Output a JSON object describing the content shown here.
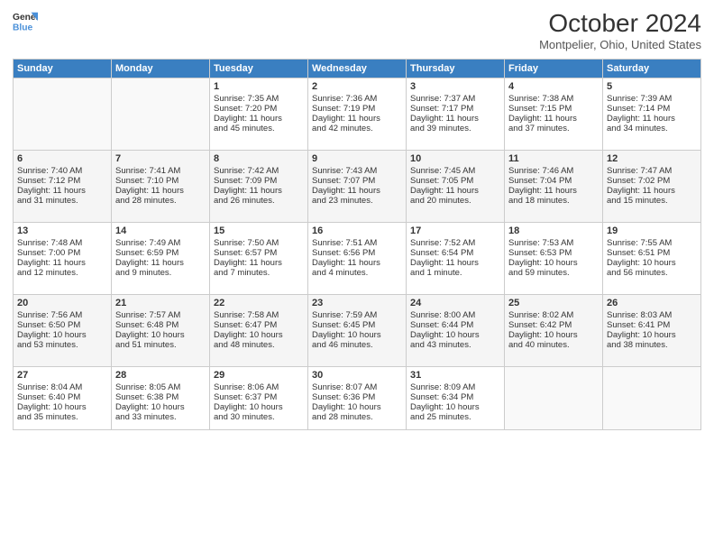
{
  "header": {
    "logo_line1": "General",
    "logo_line2": "Blue",
    "title": "October 2024",
    "subtitle": "Montpelier, Ohio, United States"
  },
  "columns": [
    "Sunday",
    "Monday",
    "Tuesday",
    "Wednesday",
    "Thursday",
    "Friday",
    "Saturday"
  ],
  "weeks": [
    [
      {
        "day": "",
        "lines": []
      },
      {
        "day": "",
        "lines": []
      },
      {
        "day": "1",
        "lines": [
          "Sunrise: 7:35 AM",
          "Sunset: 7:20 PM",
          "Daylight: 11 hours",
          "and 45 minutes."
        ]
      },
      {
        "day": "2",
        "lines": [
          "Sunrise: 7:36 AM",
          "Sunset: 7:19 PM",
          "Daylight: 11 hours",
          "and 42 minutes."
        ]
      },
      {
        "day": "3",
        "lines": [
          "Sunrise: 7:37 AM",
          "Sunset: 7:17 PM",
          "Daylight: 11 hours",
          "and 39 minutes."
        ]
      },
      {
        "day": "4",
        "lines": [
          "Sunrise: 7:38 AM",
          "Sunset: 7:15 PM",
          "Daylight: 11 hours",
          "and 37 minutes."
        ]
      },
      {
        "day": "5",
        "lines": [
          "Sunrise: 7:39 AM",
          "Sunset: 7:14 PM",
          "Daylight: 11 hours",
          "and 34 minutes."
        ]
      }
    ],
    [
      {
        "day": "6",
        "lines": [
          "Sunrise: 7:40 AM",
          "Sunset: 7:12 PM",
          "Daylight: 11 hours",
          "and 31 minutes."
        ]
      },
      {
        "day": "7",
        "lines": [
          "Sunrise: 7:41 AM",
          "Sunset: 7:10 PM",
          "Daylight: 11 hours",
          "and 28 minutes."
        ]
      },
      {
        "day": "8",
        "lines": [
          "Sunrise: 7:42 AM",
          "Sunset: 7:09 PM",
          "Daylight: 11 hours",
          "and 26 minutes."
        ]
      },
      {
        "day": "9",
        "lines": [
          "Sunrise: 7:43 AM",
          "Sunset: 7:07 PM",
          "Daylight: 11 hours",
          "and 23 minutes."
        ]
      },
      {
        "day": "10",
        "lines": [
          "Sunrise: 7:45 AM",
          "Sunset: 7:05 PM",
          "Daylight: 11 hours",
          "and 20 minutes."
        ]
      },
      {
        "day": "11",
        "lines": [
          "Sunrise: 7:46 AM",
          "Sunset: 7:04 PM",
          "Daylight: 11 hours",
          "and 18 minutes."
        ]
      },
      {
        "day": "12",
        "lines": [
          "Sunrise: 7:47 AM",
          "Sunset: 7:02 PM",
          "Daylight: 11 hours",
          "and 15 minutes."
        ]
      }
    ],
    [
      {
        "day": "13",
        "lines": [
          "Sunrise: 7:48 AM",
          "Sunset: 7:00 PM",
          "Daylight: 11 hours",
          "and 12 minutes."
        ]
      },
      {
        "day": "14",
        "lines": [
          "Sunrise: 7:49 AM",
          "Sunset: 6:59 PM",
          "Daylight: 11 hours",
          "and 9 minutes."
        ]
      },
      {
        "day": "15",
        "lines": [
          "Sunrise: 7:50 AM",
          "Sunset: 6:57 PM",
          "Daylight: 11 hours",
          "and 7 minutes."
        ]
      },
      {
        "day": "16",
        "lines": [
          "Sunrise: 7:51 AM",
          "Sunset: 6:56 PM",
          "Daylight: 11 hours",
          "and 4 minutes."
        ]
      },
      {
        "day": "17",
        "lines": [
          "Sunrise: 7:52 AM",
          "Sunset: 6:54 PM",
          "Daylight: 11 hours",
          "and 1 minute."
        ]
      },
      {
        "day": "18",
        "lines": [
          "Sunrise: 7:53 AM",
          "Sunset: 6:53 PM",
          "Daylight: 10 hours",
          "and 59 minutes."
        ]
      },
      {
        "day": "19",
        "lines": [
          "Sunrise: 7:55 AM",
          "Sunset: 6:51 PM",
          "Daylight: 10 hours",
          "and 56 minutes."
        ]
      }
    ],
    [
      {
        "day": "20",
        "lines": [
          "Sunrise: 7:56 AM",
          "Sunset: 6:50 PM",
          "Daylight: 10 hours",
          "and 53 minutes."
        ]
      },
      {
        "day": "21",
        "lines": [
          "Sunrise: 7:57 AM",
          "Sunset: 6:48 PM",
          "Daylight: 10 hours",
          "and 51 minutes."
        ]
      },
      {
        "day": "22",
        "lines": [
          "Sunrise: 7:58 AM",
          "Sunset: 6:47 PM",
          "Daylight: 10 hours",
          "and 48 minutes."
        ]
      },
      {
        "day": "23",
        "lines": [
          "Sunrise: 7:59 AM",
          "Sunset: 6:45 PM",
          "Daylight: 10 hours",
          "and 46 minutes."
        ]
      },
      {
        "day": "24",
        "lines": [
          "Sunrise: 8:00 AM",
          "Sunset: 6:44 PM",
          "Daylight: 10 hours",
          "and 43 minutes."
        ]
      },
      {
        "day": "25",
        "lines": [
          "Sunrise: 8:02 AM",
          "Sunset: 6:42 PM",
          "Daylight: 10 hours",
          "and 40 minutes."
        ]
      },
      {
        "day": "26",
        "lines": [
          "Sunrise: 8:03 AM",
          "Sunset: 6:41 PM",
          "Daylight: 10 hours",
          "and 38 minutes."
        ]
      }
    ],
    [
      {
        "day": "27",
        "lines": [
          "Sunrise: 8:04 AM",
          "Sunset: 6:40 PM",
          "Daylight: 10 hours",
          "and 35 minutes."
        ]
      },
      {
        "day": "28",
        "lines": [
          "Sunrise: 8:05 AM",
          "Sunset: 6:38 PM",
          "Daylight: 10 hours",
          "and 33 minutes."
        ]
      },
      {
        "day": "29",
        "lines": [
          "Sunrise: 8:06 AM",
          "Sunset: 6:37 PM",
          "Daylight: 10 hours",
          "and 30 minutes."
        ]
      },
      {
        "day": "30",
        "lines": [
          "Sunrise: 8:07 AM",
          "Sunset: 6:36 PM",
          "Daylight: 10 hours",
          "and 28 minutes."
        ]
      },
      {
        "day": "31",
        "lines": [
          "Sunrise: 8:09 AM",
          "Sunset: 6:34 PM",
          "Daylight: 10 hours",
          "and 25 minutes."
        ]
      },
      {
        "day": "",
        "lines": []
      },
      {
        "day": "",
        "lines": []
      }
    ]
  ]
}
